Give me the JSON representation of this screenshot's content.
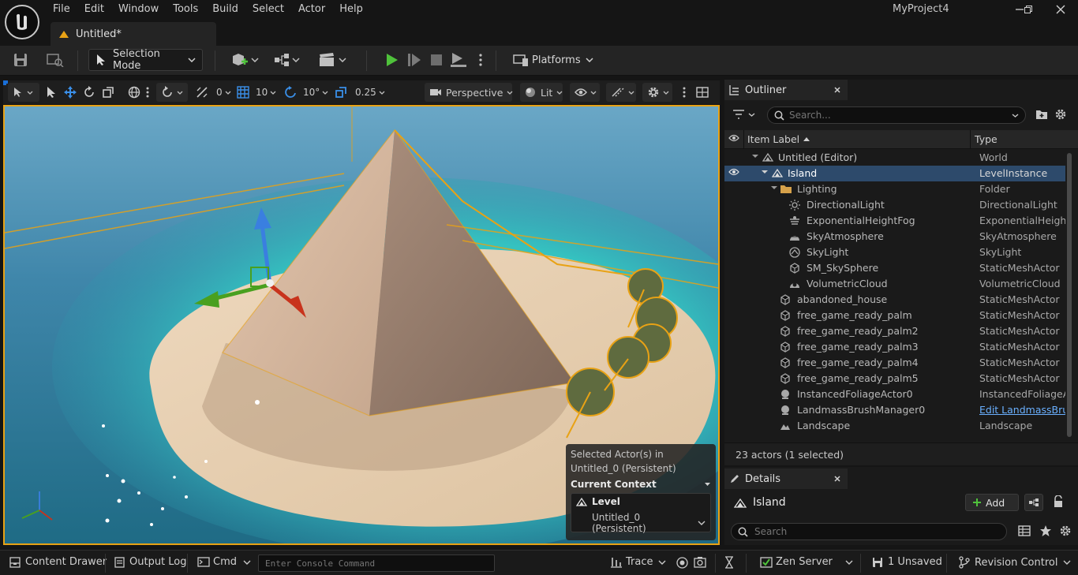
{
  "app": {
    "project_name": "MyProject4",
    "menu": [
      "File",
      "Edit",
      "Window",
      "Tools",
      "Build",
      "Select",
      "Actor",
      "Help"
    ],
    "tab_title": "Untitled*"
  },
  "toolbar": {
    "selection_mode": "Selection Mode",
    "platforms": "Platforms"
  },
  "viewport_toolbar": {
    "rotation_snap_value": "0",
    "grid_snap_value": "10",
    "angle_snap_value": "10°",
    "scale_snap_value": "0.25",
    "perspective": "Perspective",
    "lit": "Lit"
  },
  "selection_panel": {
    "line1": "Selected Actor(s) in",
    "line2": "Untitled_0 (Persistent)",
    "context_label": "Current Context",
    "level_label": "Level",
    "level_value": "Untitled_0 (Persistent)"
  },
  "outliner": {
    "tab_label": "Outliner",
    "search_placeholder": "Search...",
    "col_label": "Item Label",
    "col_type": "Type",
    "rows": [
      {
        "label": "Untitled (Editor)",
        "type": "World"
      },
      {
        "label": "Island",
        "type": "LevelInstance"
      },
      {
        "label": "Lighting",
        "type": "Folder"
      },
      {
        "label": "DirectionalLight",
        "type": "DirectionalLight"
      },
      {
        "label": "ExponentialHeightFog",
        "type": "ExponentialHeightF"
      },
      {
        "label": "SkyAtmosphere",
        "type": "SkyAtmosphere"
      },
      {
        "label": "SkyLight",
        "type": "SkyLight"
      },
      {
        "label": "SM_SkySphere",
        "type": "StaticMeshActor"
      },
      {
        "label": "VolumetricCloud",
        "type": "VolumetricCloud"
      },
      {
        "label": "abandoned_house",
        "type": "StaticMeshActor"
      },
      {
        "label": "free_game_ready_palm",
        "type": "StaticMeshActor"
      },
      {
        "label": "free_game_ready_palm2",
        "type": "StaticMeshActor"
      },
      {
        "label": "free_game_ready_palm3",
        "type": "StaticMeshActor"
      },
      {
        "label": "free_game_ready_palm4",
        "type": "StaticMeshActor"
      },
      {
        "label": "free_game_ready_palm5",
        "type": "StaticMeshActor"
      },
      {
        "label": "InstancedFoliageActor0",
        "type": "InstancedFoliageAc"
      },
      {
        "label": "LandmassBrushManager0",
        "type": "Edit LandmassBrus"
      },
      {
        "label": "Landscape",
        "type": "Landscape"
      }
    ],
    "footer": "23 actors (1 selected)"
  },
  "details": {
    "tab_label": "Details",
    "actor_name": "Island",
    "add_label": "Add",
    "search_placeholder": "Search"
  },
  "statusbar": {
    "content_drawer": "Content Drawer",
    "output_log": "Output Log",
    "cmd": "Cmd",
    "console_placeholder": "Enter Console Command",
    "trace": "Trace",
    "zen_server": "Zen Server",
    "unsaved": "1 Unsaved",
    "revision_control": "Revision Control"
  },
  "colors": {
    "selection_outline": "#e8a215",
    "play_green": "#4fc23b",
    "selected_row": "#2d4a6b",
    "link_blue": "#6ab0ff"
  }
}
